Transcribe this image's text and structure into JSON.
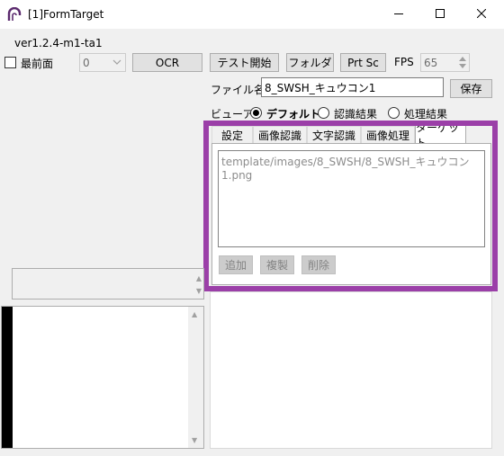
{
  "window": {
    "title": "[1]FormTarget",
    "icon": "app-arch-icon",
    "controls": [
      "minimize-icon",
      "maximize-icon",
      "close-icon"
    ]
  },
  "version": "ver1.2.4-m1-ta1",
  "toolbar": {
    "topmost_label": "最前面",
    "topmost_checked": false,
    "combo_value": "0",
    "ocr_label": "OCR",
    "test_start_label": "テスト開始",
    "folder_label": "フォルダ",
    "prtsc_label": "Prt Sc",
    "fps_label": "FPS",
    "fps_value": "65"
  },
  "file": {
    "label": "ファイル名",
    "value": "8_SWSH_キュウコン1",
    "save_label": "保存"
  },
  "viewer": {
    "label": "ビューア",
    "options": [
      "デフォルト",
      "認識結果",
      "処理結果"
    ],
    "selected": "デフォルト"
  },
  "tabs": [
    "設定",
    "画像認識",
    "文字認識",
    "画像処理",
    "ターゲット"
  ],
  "active_tab": "ターゲット",
  "target": {
    "list_items": [
      "template/images/8_SWSH/8_SWSH_キュウコン1.png"
    ],
    "add_label": "追加",
    "copy_label": "複製",
    "delete_label": "削除"
  },
  "colors": {
    "highlight": "#9b3fa8",
    "window_bg": "#f0f0f0"
  }
}
